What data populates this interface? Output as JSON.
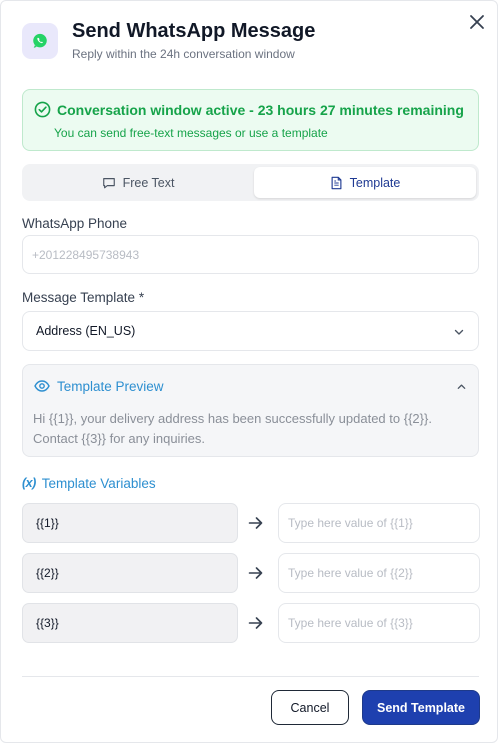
{
  "header": {
    "title": "Send WhatsApp Message",
    "subtitle": "Reply within the 24h conversation window"
  },
  "alert": {
    "title": "Conversation window active - 23 hours 27 minutes remaining",
    "text": "You can send free-text messages or use a template"
  },
  "tabs": [
    {
      "label": "Free Text",
      "active": false
    },
    {
      "label": "Template",
      "active": true
    }
  ],
  "phone": {
    "label": "WhatsApp Phone",
    "placeholder": "+201228495738943"
  },
  "template_select": {
    "label": "Message Template *",
    "value": "Address (EN_US)"
  },
  "preview": {
    "title": "Template Preview",
    "body": "Hi {{1}}, your delivery address has been successfully updated to {{2}}. Contact {{3}} for any inquiries."
  },
  "variables": {
    "title": "Template Variables",
    "icon_text": "(x)",
    "rows": [
      {
        "key": "{{1}}",
        "placeholder": "Type here value of {{1}}"
      },
      {
        "key": "{{2}}",
        "placeholder": "Type here value of {{2}}"
      },
      {
        "key": "{{3}}",
        "placeholder": "Type here value of {{3}}"
      }
    ]
  },
  "footer": {
    "cancel_label": "Cancel",
    "send_label": "Send Template"
  },
  "colors": {
    "whatsapp_green": "#25d366",
    "success_green": "#16a34a",
    "accent_blue": "#2d8fd0",
    "primary_button": "#1e40af"
  },
  "icons": {
    "header": "whatsapp-icon",
    "close": "close-icon",
    "alert": "check-circle-icon",
    "free_text_tab": "message-square-icon",
    "template_tab": "file-text-icon",
    "select": "chevron-down-icon",
    "preview": "eye-icon",
    "preview_toggle": "chevron-up-icon",
    "variables": "variable-icon",
    "row_arrow": "arrow-right-icon"
  }
}
